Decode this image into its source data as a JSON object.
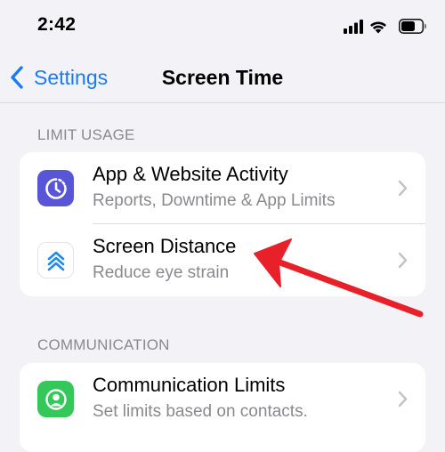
{
  "status_bar": {
    "time": "2:42",
    "icons": [
      "cellular-signal-icon",
      "wifi-icon",
      "battery-icon"
    ]
  },
  "nav": {
    "back_label": "Settings",
    "title": "Screen Time"
  },
  "sections": [
    {
      "header": "LIMIT USAGE",
      "rows": [
        {
          "title": "App & Website Activity",
          "subtitle": "Reports, Downtime & App Limits",
          "icon": "app-activity-icon",
          "icon_color": "#5856d6"
        },
        {
          "title": "Screen Distance",
          "subtitle": "Reduce eye strain",
          "icon": "screen-distance-icon",
          "icon_color": "#ffffff"
        }
      ]
    },
    {
      "header": "COMMUNICATION",
      "rows": [
        {
          "title": "Communication Limits",
          "subtitle": "Set limits based on contacts.",
          "icon": "communication-limits-icon",
          "icon_color": "#34c759"
        }
      ]
    }
  ],
  "colors": {
    "accent": "#1a7bf2",
    "background": "#f2f2f7",
    "annotation_arrow": "#e8202a"
  }
}
